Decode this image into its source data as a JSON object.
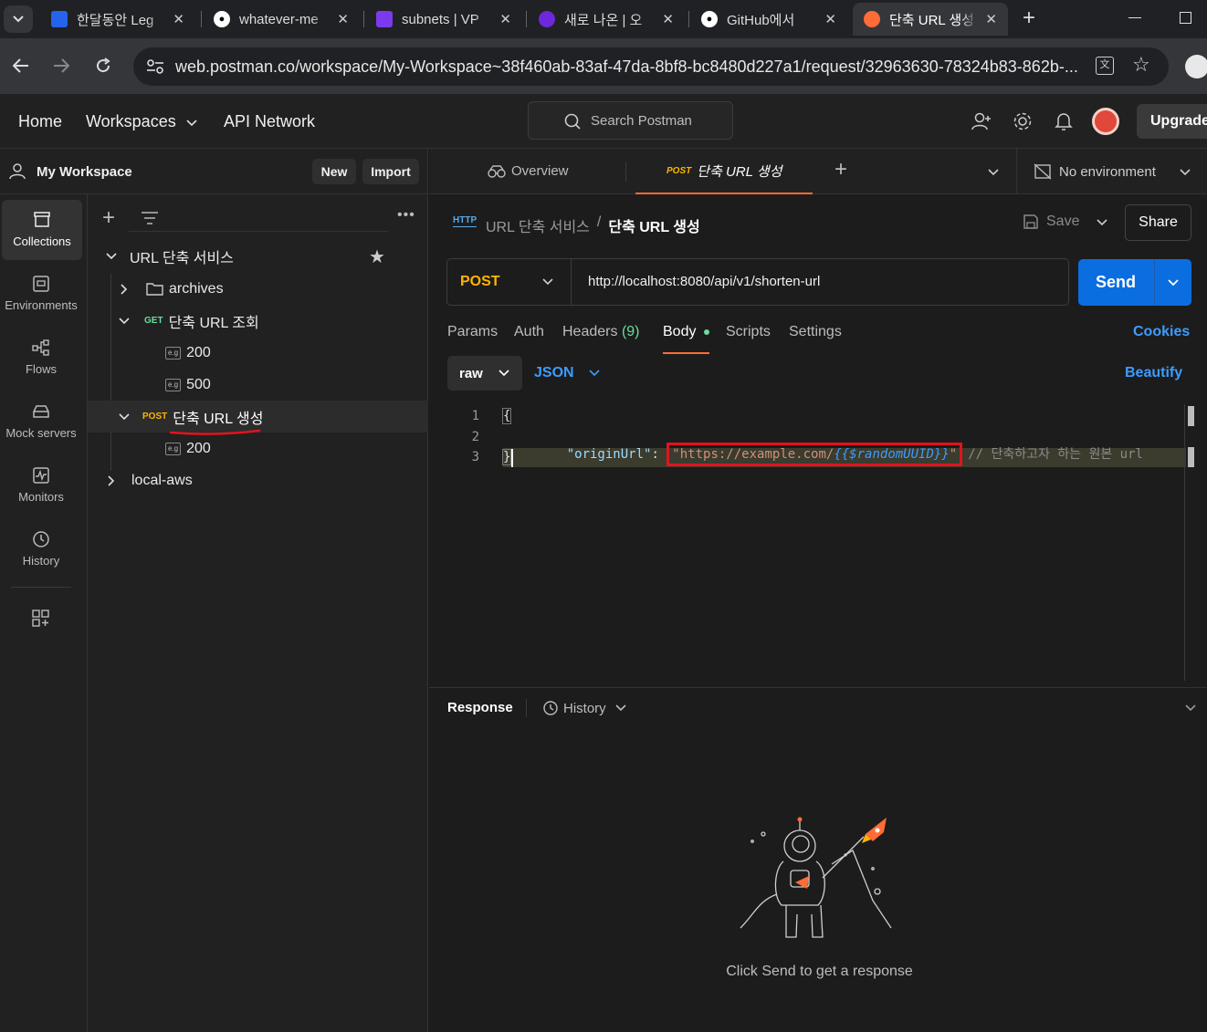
{
  "browser": {
    "tabs": [
      {
        "title": "한달동안 Leg",
        "favicon": "blue-square-icon"
      },
      {
        "title": "whatever-me",
        "favicon": "github-icon"
      },
      {
        "title": "subnets | VP",
        "favicon": "vpc-icon"
      },
      {
        "title": "새로 나온 | 오",
        "favicon": "purple-logo-icon"
      },
      {
        "title": "GitHub에서 ",
        "favicon": "github-icon"
      },
      {
        "title": "단축 URL 생성",
        "favicon": "postman-icon"
      }
    ],
    "url": "web.postman.co/workspace/My-Workspace~38f460ab-83af-47da-8bf8-bc8480d227a1/request/32963630-78324b83-862b-..."
  },
  "topbar": {
    "home": "Home",
    "workspaces": "Workspaces",
    "api_network": "API Network",
    "search_placeholder": "Search Postman",
    "upgrade": "Upgrade"
  },
  "workspace": {
    "name": "My Workspace",
    "new_label": "New",
    "import_label": "Import"
  },
  "rail": [
    {
      "label": "Collections",
      "icon": "collections-icon"
    },
    {
      "label": "Environments",
      "icon": "environments-icon"
    },
    {
      "label": "Flows",
      "icon": "flows-icon"
    },
    {
      "label": "Mock servers",
      "icon": "mock-servers-icon"
    },
    {
      "label": "Monitors",
      "icon": "monitors-icon"
    },
    {
      "label": "History",
      "icon": "history-icon"
    }
  ],
  "tree": {
    "collection": "URL 단축 서비스",
    "folder": "archives",
    "get_method": "GET",
    "get_name": "단축 URL 조회",
    "get_examples": [
      "200",
      "500"
    ],
    "post_method": "POST",
    "post_name": "단축 URL 생성",
    "post_examples": [
      "200"
    ],
    "example_badge": "e.g",
    "collection2": "local-aws"
  },
  "request_tabs": {
    "overview": "Overview",
    "active_method": "POST",
    "active_name": "단축 URL 생성",
    "environment": "No environment"
  },
  "breadcrumb": {
    "parent": "URL 단축 서비스",
    "sep": "/",
    "current": "단축 URL 생성",
    "save": "Save",
    "share": "Share"
  },
  "request": {
    "method": "POST",
    "url": "http://localhost:8080/api/v1/shorten-url",
    "send": "Send"
  },
  "subtabs": {
    "params": "Params",
    "auth": "Auth",
    "headers": "Headers",
    "headers_count": "(9)",
    "body": "Body",
    "scripts": "Scripts",
    "settings": "Settings",
    "cookies": "Cookies"
  },
  "body_options": {
    "mode": "raw",
    "format": "JSON",
    "beautify": "Beautify"
  },
  "editor": {
    "line_numbers": [
      "1",
      "2",
      "3"
    ],
    "line1": "{",
    "key": "\"originUrl\"",
    "colon": ": ",
    "q1": "\"",
    "value_prefix": "https://example.com/",
    "variable": "{{$randomUUID}}",
    "q2": "\"",
    "comment": "// 단축하고자 하는 원본 url",
    "line3": "}"
  },
  "response": {
    "title": "Response",
    "history": "History",
    "empty_message": "Click Send to get a response"
  },
  "colors": {
    "accent_orange": "#ff6c37",
    "post": "#ffb400",
    "get": "#6bdd9a",
    "send_blue": "#0b6ee0",
    "link_blue": "#3d9cff",
    "annotation_red": "#e0141e"
  }
}
